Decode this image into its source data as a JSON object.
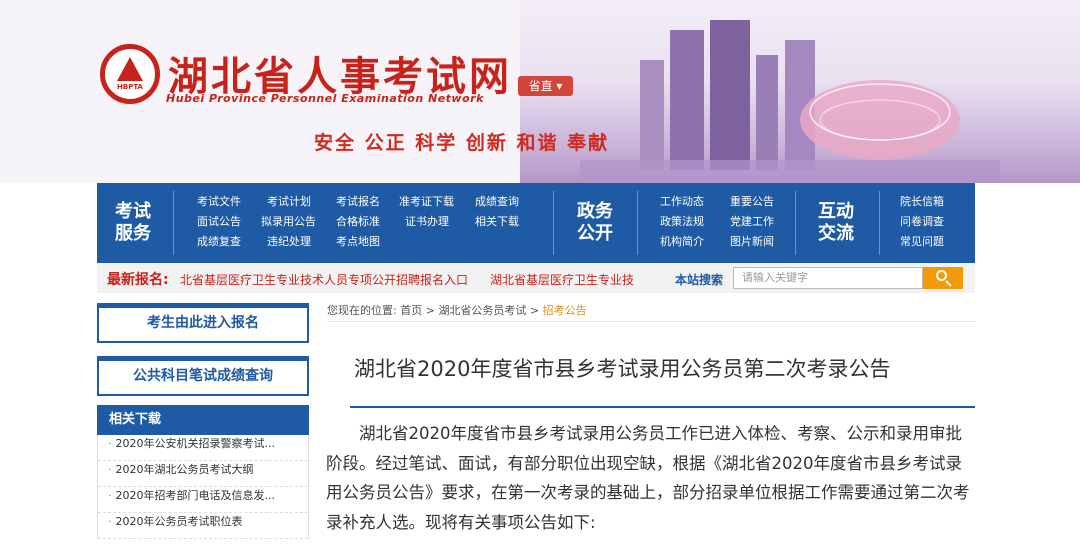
{
  "header": {
    "site_title": "湖北省人事考试网",
    "site_subtitle": "Hubei Province Personnel Examination Network",
    "logo_text": "HBPTA",
    "province_button": "省直",
    "slogan": "安全 公正 科学 创新 和谐 奉献"
  },
  "nav": {
    "exam_service": {
      "title": "考试服务",
      "links": [
        "考试文件",
        "考试计划",
        "考试报名",
        "准考证下载",
        "成绩查询",
        "面试公告",
        "拟录用公告",
        "合格标准",
        "证书办理",
        "相关下载",
        "成绩复查",
        "违纪处理",
        "考点地图"
      ]
    },
    "government": {
      "title": "政务公开",
      "links": [
        "工作动态",
        "重要公告",
        "政策法规",
        "党建工作",
        "机构简介",
        "图片新闻"
      ]
    },
    "interaction": {
      "title": "互动交流",
      "links": [
        "院长信箱",
        "问卷调查",
        "常见问题"
      ]
    }
  },
  "ticker": {
    "label": "最新报名:",
    "items": [
      "北省基层医疗卫生专业技术人员专项公开招聘报名入口",
      "湖北省基层医疗卫生专业技"
    ],
    "search_label": "本站搜索",
    "search_placeholder": "请输入关键字"
  },
  "sidebar": {
    "register_button": "考生由此进入报名",
    "score_button": "公共科目笔试成绩查询",
    "downloads_title": "相关下载",
    "downloads": [
      "2020年公安机关招录警察考试...",
      "2020年湖北公务员考试大纲",
      "2020年招考部门电话及信息发...",
      "2020年公务员考试职位表"
    ]
  },
  "breadcrumb": {
    "prefix": "您现在的位置:",
    "home": "首页",
    "sep": ">",
    "section": "湖北省公务员考试",
    "current": "招考公告"
  },
  "article": {
    "title": "湖北省2020年度省市县乡考试录用公务员第二次考录公告",
    "body": "湖北省2020年度省市县乡考试录用公务员工作已进入体检、考察、公示和录用审批阶段。经过笔试、面试，有部分职位出现空缺，根据《湖北省2020年度省市县乡考试录用公务员公告》要求，在第一次考录的基础上，部分招录单位根据工作需要通过第二次考录补充人选。现将有关事项公告如下:"
  },
  "colors": {
    "brand_red": "#c8231a",
    "nav_blue": "#1f5aa5",
    "search_orange": "#f29a0a"
  }
}
